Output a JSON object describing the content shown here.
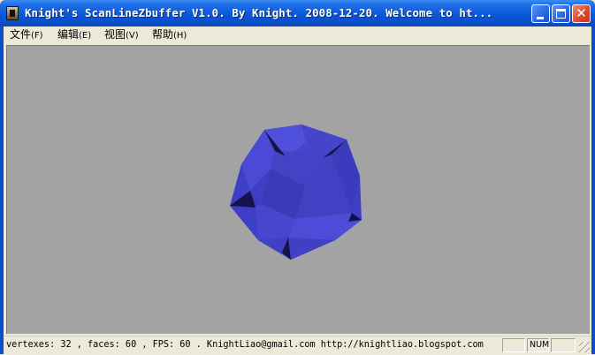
{
  "window": {
    "title": "Knight's ScanLineZbuffer V1.0. By Knight. 2008-12-20.  Welcome to ht...",
    "icon": "app-icon",
    "controls": [
      "minimize-icon",
      "maximize-icon",
      "close-icon"
    ]
  },
  "menu": {
    "file": {
      "label": "文件",
      "mnemonic": "(F)"
    },
    "edit": {
      "label": "编辑",
      "mnemonic": "(E)"
    },
    "view": {
      "label": "视图",
      "mnemonic": "(V)"
    },
    "help": {
      "label": "帮助",
      "mnemonic": "(H)"
    }
  },
  "statusbar": {
    "info": "vertexes: 32 , faces: 60 , FPS: 60 .  KnightLiao@gmail.com  http://knightliao.blogspot.com",
    "num": "NUM"
  },
  "colors": {
    "viewport_bg": "#a3a3a3",
    "model_blue": "#4848d6",
    "titlebar": "#0a57d8"
  }
}
